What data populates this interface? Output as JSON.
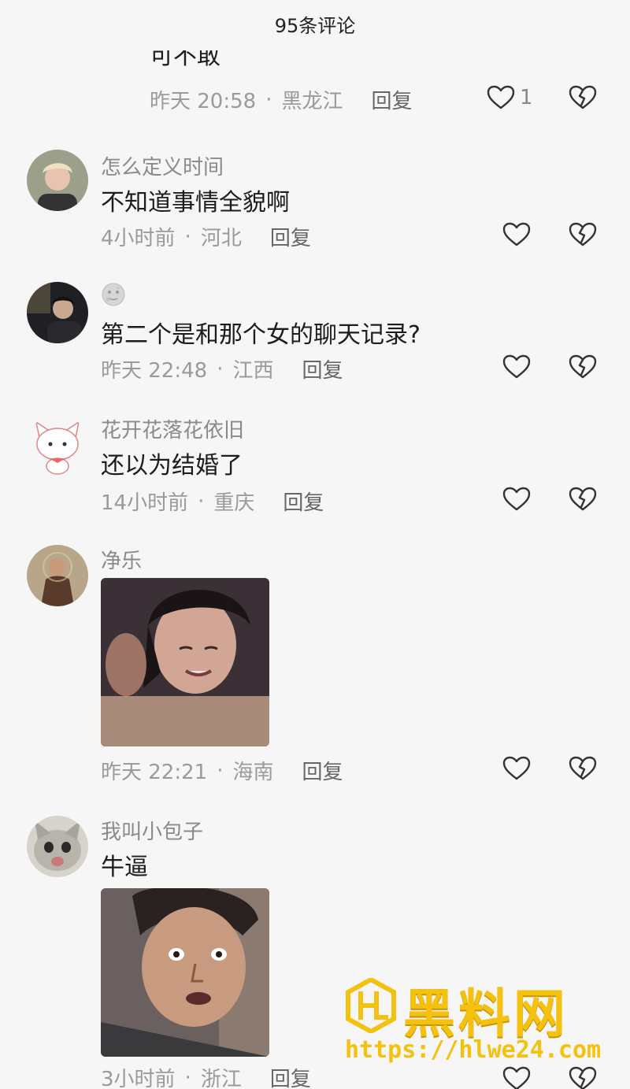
{
  "header": {
    "title": "95条评论"
  },
  "comments": [
    {
      "username": "",
      "text": "可不敢",
      "time": "昨天 20:58",
      "location": "黑龙江",
      "reply": "回复",
      "likes": "1"
    },
    {
      "username": "怎么定义时间",
      "text": "不知道事情全貌啊",
      "time": "4小时前",
      "location": "河北",
      "reply": "回复"
    },
    {
      "username": "",
      "username_badge": "moon-emoji-icon",
      "text": "第二个是和那个女的聊天记录?",
      "time": "昨天 22:48",
      "location": "江西",
      "reply": "回复"
    },
    {
      "username": "花开花落花依旧",
      "text": "还以为结婚了",
      "time": "14小时前",
      "location": "重庆",
      "reply": "回复"
    },
    {
      "username": "净乐",
      "text": "",
      "media": "image-woman-smiling",
      "time": "昨天 22:21",
      "location": "海南",
      "reply": "回复"
    },
    {
      "username": "我叫小包子",
      "text": "牛逼",
      "media": "image-surprised-man",
      "time": "3小时前",
      "location": "浙江",
      "reply": "回复"
    }
  ],
  "separator": "·",
  "watermark": {
    "title": "黑料网",
    "url": "https://hlwe24.com"
  },
  "colors": {
    "background": "#f6f6f6",
    "meta_text": "#9a9a9a",
    "watermark": "#f4c10f"
  }
}
